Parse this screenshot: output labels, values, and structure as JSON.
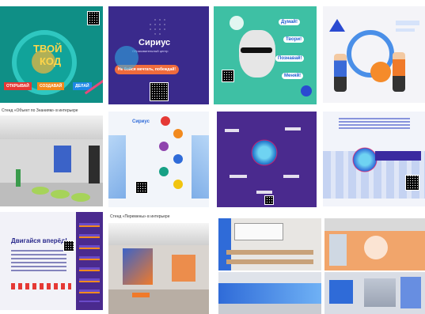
{
  "tile1": {
    "title_top": "ТВОЙ",
    "title_bottom": "КОД",
    "btn_open": "ОТКРЫВАЙ",
    "btn_create": "СОЗДАВАЙ",
    "btn_do": "ДЕЛАЙ",
    "bg": "#0f8f86"
  },
  "tile2": {
    "brand": "Сириус",
    "subtitle": "Образовательный центр",
    "slogan": "Не бойся мечтать, побеждай!",
    "bg": "#3a2a8c"
  },
  "tile3": {
    "word1": "Думай!",
    "word2": "Твори!",
    "word3": "Познавай!",
    "word4": "Меняй!",
    "bg": "#3ec0a4"
  },
  "tile4": {
    "bg": "#f4f4f8"
  },
  "caption1": "Стенд «Объект по Знаниям» в интерьере",
  "tile5": {
    "bg": "#d8d8d8"
  },
  "tile6": {
    "brand": "Сириус",
    "bg": "#f2f5fa"
  },
  "tile7": {
    "bg": "#4a2a8e"
  },
  "tile8": {
    "bg": "#f2f4fa"
  },
  "tile9": {
    "title": "Двигайся вперёд!",
    "bg": "#f2f2f8"
  },
  "caption2": "Стенд «Перемены» в интерьере",
  "tile10": {
    "bg": "#d9d4cf"
  },
  "tile11": {
    "bg": "#e8e6e3"
  },
  "tile12": {
    "bg": "#dfe3ea"
  },
  "tile13": {
    "bg": "#f1a56b"
  },
  "tile14": {
    "bg": "#d9dde5"
  },
  "colors": {
    "accent_blue": "#2f6bd8",
    "accent_purple": "#5a3aa8",
    "accent_orange": "#f07a2a"
  }
}
